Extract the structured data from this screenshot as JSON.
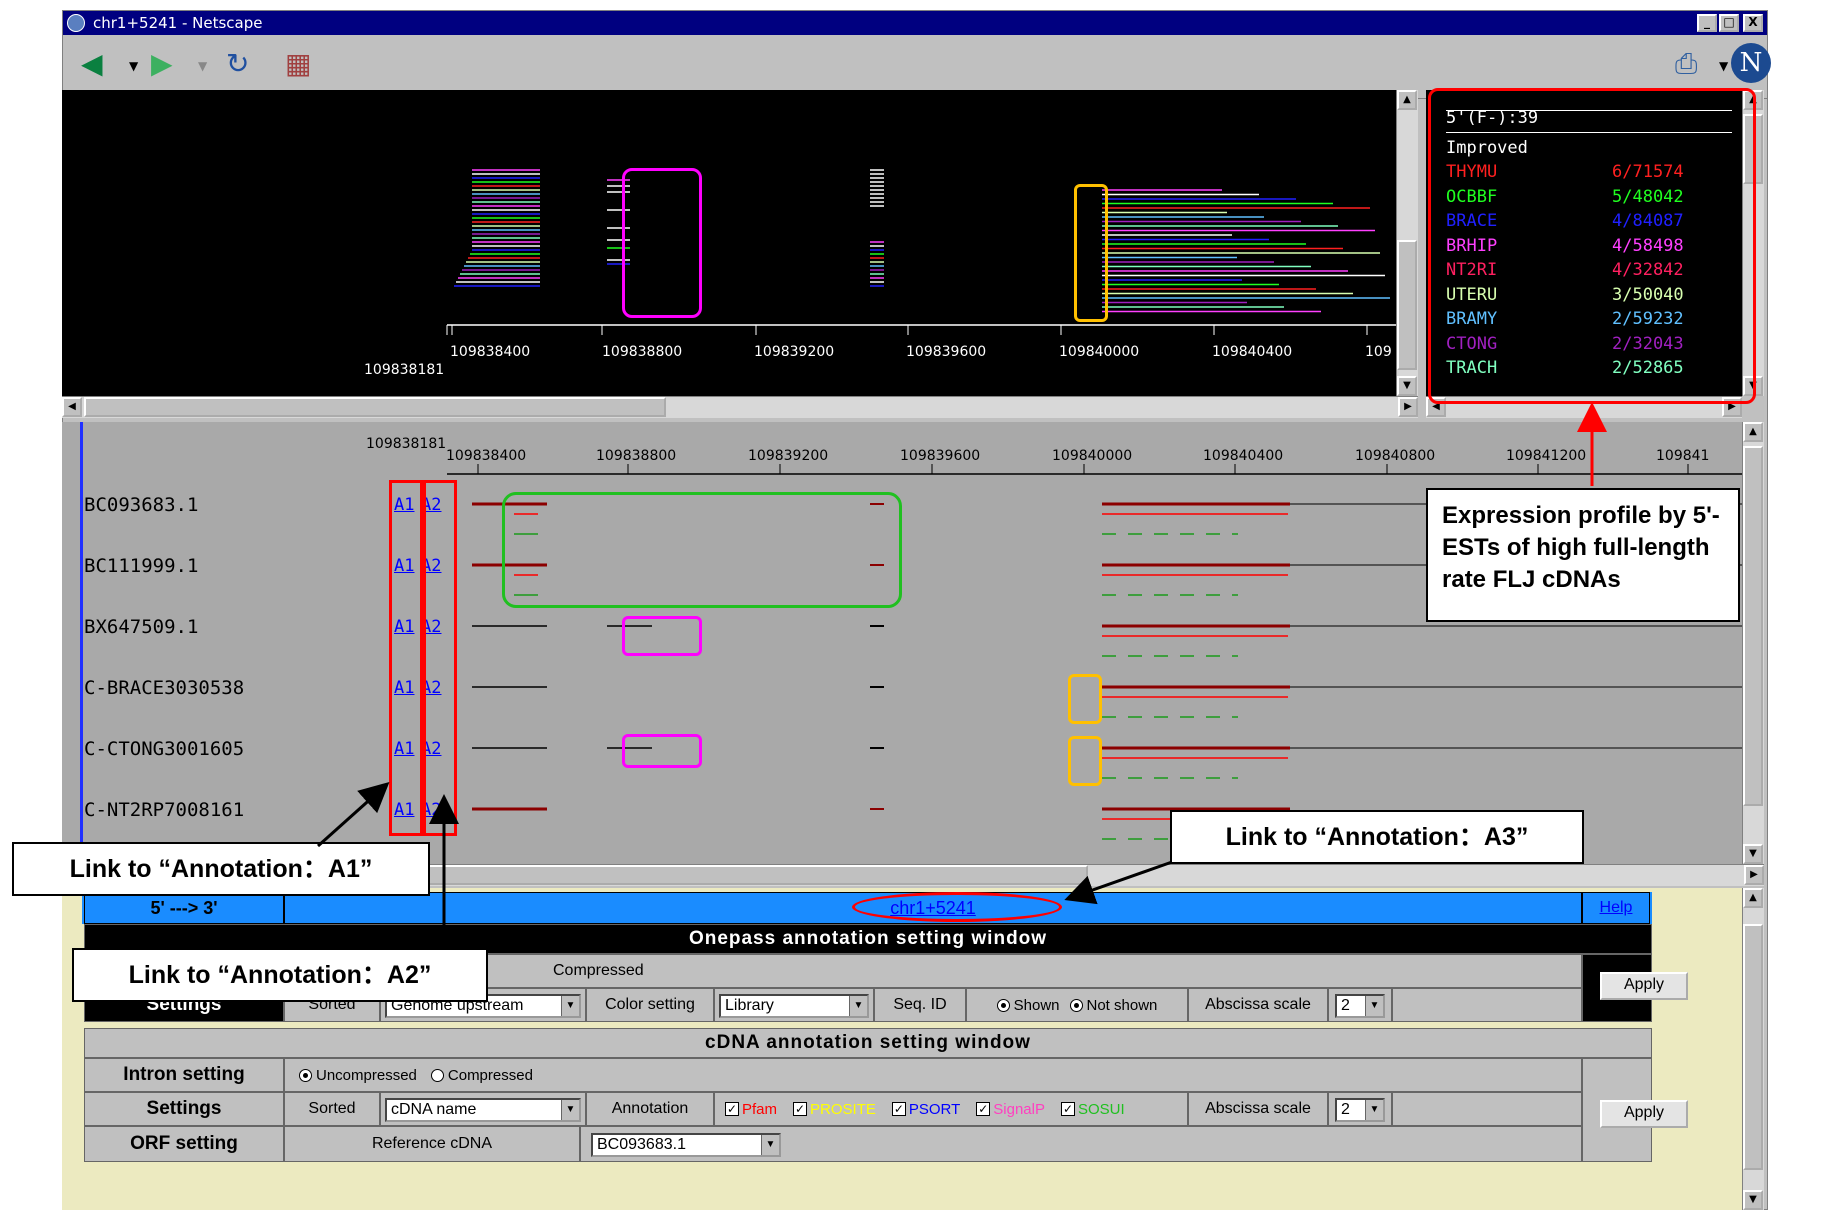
{
  "window": {
    "title": "chr1+5241 - Netscape",
    "minimize": "_",
    "maximize": "□",
    "close": "X"
  },
  "top_plot": {
    "axis_start": "109838181",
    "ticks": [
      "109838400",
      "109838800",
      "109839200",
      "109839600",
      "109840000",
      "109840400",
      "109"
    ]
  },
  "legend": {
    "header": "5'(F-):39",
    "subheader": "Improved",
    "rows": [
      {
        "lib": "THYMU",
        "val": "6/71574",
        "color": "#ff2020"
      },
      {
        "lib": "OCBBF",
        "val": "5/48042",
        "color": "#20ff20"
      },
      {
        "lib": "BRACE",
        "val": "4/84087",
        "color": "#2020ff"
      },
      {
        "lib": "BRHIP",
        "val": "4/58498",
        "color": "#ff40ff"
      },
      {
        "lib": "NT2RI",
        "val": "4/32842",
        "color": "#ff2060"
      },
      {
        "lib": "UTERU",
        "val": "3/50040",
        "color": "#d8ffb0"
      },
      {
        "lib": "BRAMY",
        "val": "2/59232",
        "color": "#60c0ff"
      },
      {
        "lib": "CTONG",
        "val": "2/32043",
        "color": "#a020c0"
      },
      {
        "lib": "TRACH",
        "val": "2/52865",
        "color": "#80ffc0"
      }
    ]
  },
  "gene_view": {
    "axis_start": "109838181",
    "ticks": [
      "109838400",
      "109838800",
      "109839200",
      "109839600",
      "109840000",
      "109840400",
      "109840800",
      "109841200",
      "109841"
    ],
    "rows": [
      {
        "name": "BC093683.1",
        "a1": "A1",
        "a2": "A2"
      },
      {
        "name": "BC111999.1",
        "a1": "A1",
        "a2": "A2"
      },
      {
        "name": "BX647509.1",
        "a1": "A1",
        "a2": "A2"
      },
      {
        "name": "C-BRACE3030538",
        "a1": "A1",
        "a2": "A2"
      },
      {
        "name": "C-CTONG3001605",
        "a1": "A1",
        "a2": "A2"
      },
      {
        "name": "C-NT2RP7008161",
        "a1": "A1",
        "a2": "A2"
      }
    ]
  },
  "callouts": {
    "expression": "Expression profile by 5'-ESTs of high full-length rate FLJ cDNAs",
    "a1": "Link to “Annotation：A1”",
    "a2": "Link to “Annotation：A2”",
    "a3": "Link to “Annotation：A3”"
  },
  "settings_panel": {
    "direction": "5' ---> 3'",
    "link": "chr1+5241",
    "help": "Help",
    "onepass": {
      "title": "Onepass annotation setting window",
      "compressed": "Compressed",
      "settings": "Settings",
      "sorted": "Sorted",
      "sort_value": "Genome upstream",
      "color_setting": "Color setting",
      "color_value": "Library",
      "seq_id": "Seq. ID",
      "shown": "Shown",
      "not_shown": "Not shown",
      "abscissa": "Abscissa scale",
      "scale": "2",
      "apply": "Apply"
    },
    "cdna": {
      "title": "cDNA annotation setting window",
      "intron_setting": "Intron setting",
      "uncompressed": "Uncompressed",
      "compressed": "Compressed",
      "settings": "Settings",
      "sorted": "Sorted",
      "sort_value": "cDNA name",
      "annotation": "Annotation",
      "checks": [
        {
          "label": "Pfam",
          "color": "#ff0000"
        },
        {
          "label": "PROSITE",
          "color": "#ffff00"
        },
        {
          "label": "PSORT",
          "color": "#0000ff"
        },
        {
          "label": "SignalP",
          "color": "#ff40c0"
        },
        {
          "label": "SOSUI",
          "color": "#20c020"
        }
      ],
      "abscissa": "Abscissa scale",
      "scale": "2",
      "apply": "Apply",
      "orf_setting": "ORF setting",
      "reference": "Reference cDNA",
      "reference_value": "BC093683.1"
    }
  }
}
